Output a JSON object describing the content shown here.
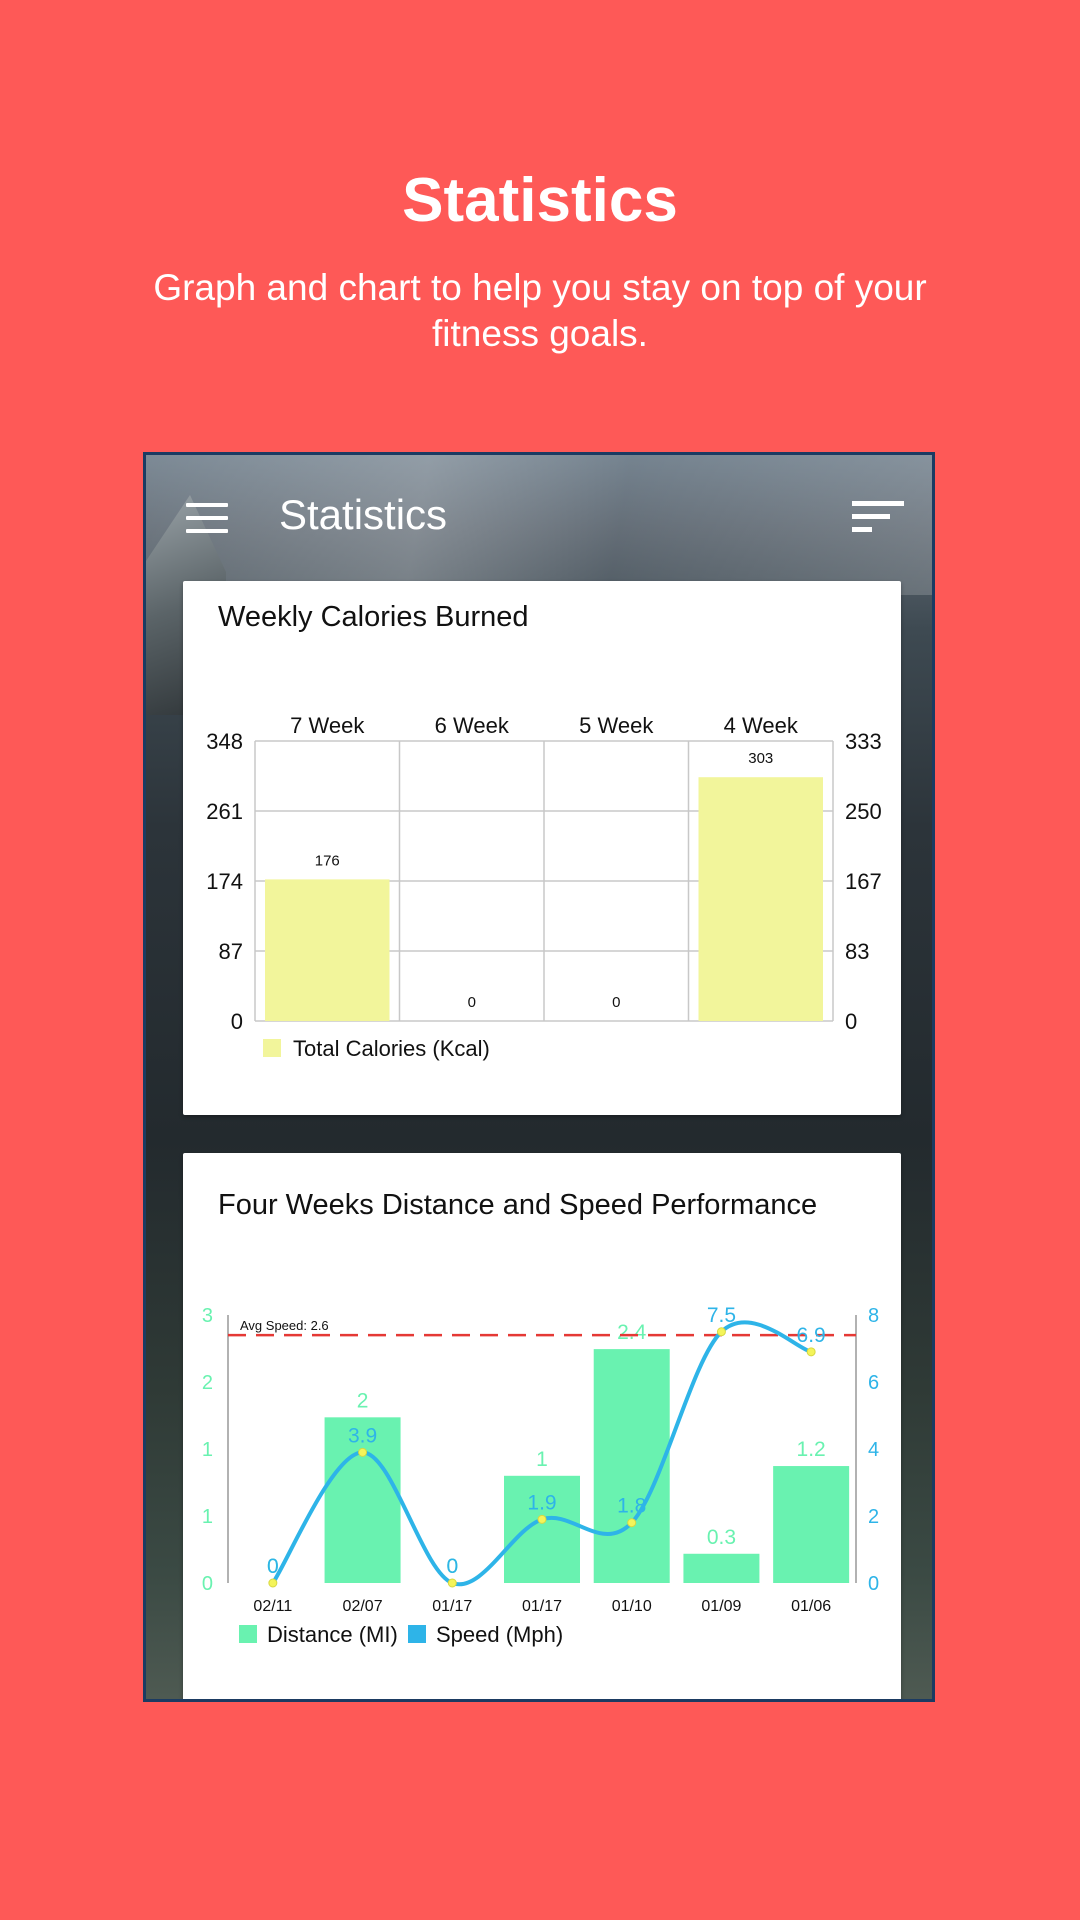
{
  "promo": {
    "title": "Statistics",
    "subtitle": "Graph and chart to help you stay on top of your fitness goals."
  },
  "appbar": {
    "title": "Statistics",
    "menu_icon": "hamburger-menu-icon",
    "sort_icon": "sort-lines-icon"
  },
  "colors": {
    "background": "#FE5957",
    "calorie_bar": "#F2F59B",
    "distance_bar": "#69F2B0",
    "speed_line": "#2EB4E8",
    "avg_line": "#E53935"
  },
  "chart_data": [
    {
      "type": "bar",
      "title": "Weekly Calories Burned",
      "categories": [
        "7 Week",
        "6 Week",
        "5 Week",
        "4 Week"
      ],
      "series": [
        {
          "name": "Total Calories (Kcal)",
          "values": [
            176,
            0,
            0,
            303
          ]
        }
      ],
      "value_labels": [
        "176",
        "0",
        "0",
        "303"
      ],
      "left_axis_ticks": [
        "348",
        "261",
        "174",
        "87",
        "0"
      ],
      "right_axis_ticks": [
        "333",
        "250",
        "167",
        "83",
        "0"
      ],
      "ylim_left": [
        0,
        348
      ],
      "ylim_right": [
        0,
        333
      ],
      "grid": true,
      "legend_position": "bottom-left"
    },
    {
      "type": "bar",
      "title": "Four Weeks Distance and Speed Performance",
      "categories": [
        "02/11",
        "02/07",
        "01/17",
        "01/17",
        "01/10",
        "01/09",
        "01/06"
      ],
      "series": [
        {
          "name": "Distance (MI)",
          "type": "bar",
          "axis": "left",
          "values": [
            0,
            1.7,
            0,
            1.1,
            2.4,
            0.3,
            1.2
          ],
          "labels": [
            "0",
            "2",
            "0",
            "1",
            "2.4",
            "0.3",
            "1.2"
          ]
        },
        {
          "name": "Speed (Mph)",
          "type": "line",
          "axis": "right",
          "values": [
            0,
            3.9,
            0,
            1.9,
            1.8,
            7.5,
            6.9
          ],
          "labels": [
            "0",
            "3.9",
            "0",
            "1.9",
            "1.8",
            "7.5",
            "6.9"
          ]
        }
      ],
      "avg_line": {
        "label": "Avg Speed: 2.6",
        "value": 7.4
      },
      "left_axis_ticks": [
        "3",
        "2",
        "1",
        "1",
        "0"
      ],
      "right_axis_ticks": [
        "8",
        "6",
        "4",
        "2",
        "0"
      ],
      "ylim_left": [
        0,
        2.75
      ],
      "ylim_right": [
        0,
        8
      ],
      "grid": false,
      "legend_position": "bottom-left"
    }
  ]
}
